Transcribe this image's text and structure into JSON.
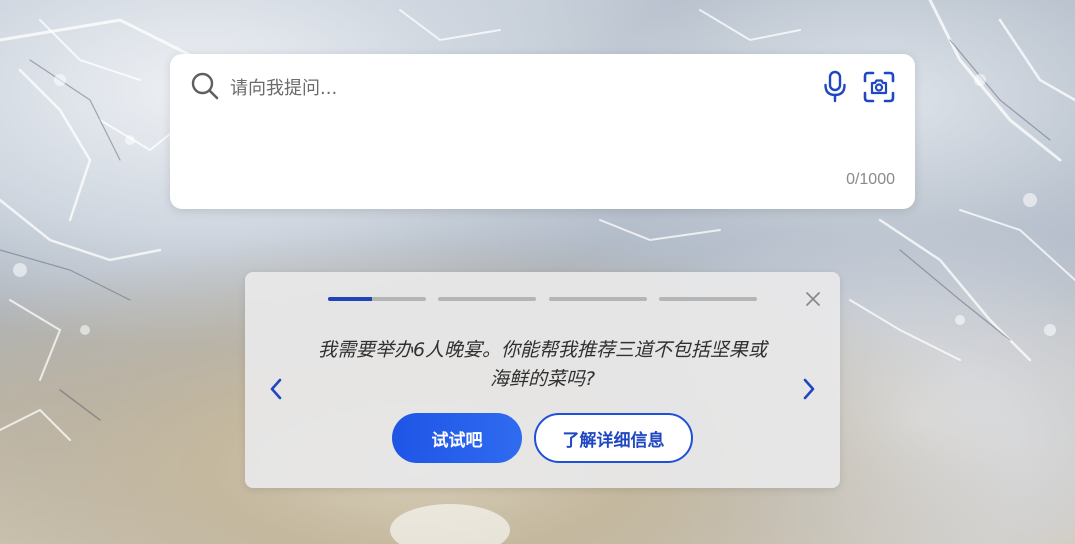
{
  "colors": {
    "accent": "#1f55e6",
    "progress_active": "#1f44b8",
    "progress_inactive": "#b5b5b5",
    "icon_blue": "#1f47c2",
    "card_bg": "#e8e8ea"
  },
  "search": {
    "placeholder": "请向我提问...",
    "value": "",
    "char_counter": "0/1000",
    "icons": [
      "search-icon",
      "microphone-icon",
      "camera-icon"
    ]
  },
  "suggestion": {
    "prompt": "我需要举办6人晚宴。你能帮我推荐三道不包括坚果或海鲜的菜吗?",
    "try_label": "试试吧",
    "learn_more_label": "了解详细信息",
    "progress": [
      0.45,
      0,
      0,
      0
    ],
    "icons": [
      "close-icon",
      "chevron-left-icon",
      "chevron-right-icon"
    ]
  }
}
